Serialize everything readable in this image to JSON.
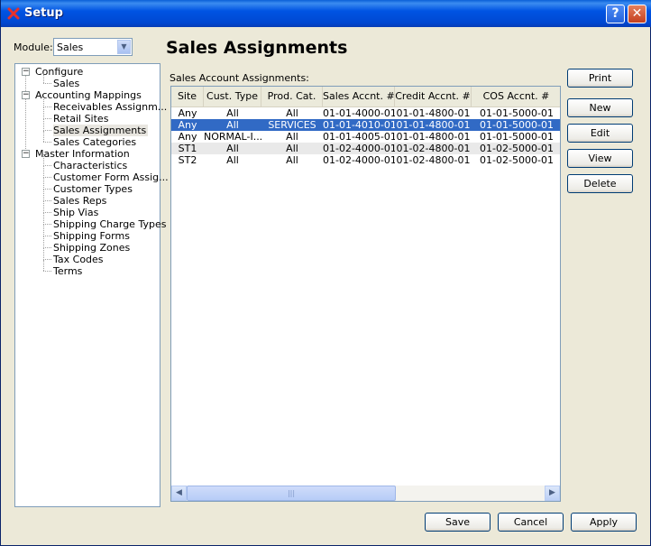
{
  "window": {
    "title": "Setup",
    "help_glyph": "?",
    "close_glyph": "✕"
  },
  "module": {
    "label": "Module:",
    "value": "Sales",
    "arrow": "▼"
  },
  "tree": [
    {
      "label": "Configure",
      "level": 0,
      "expander": "−"
    },
    {
      "label": "Sales",
      "level": 1
    },
    {
      "label": "Accounting Mappings",
      "level": 0,
      "expander": "−"
    },
    {
      "label": "Receivables Assignm...",
      "level": 1
    },
    {
      "label": "Retail Sites",
      "level": 1
    },
    {
      "label": "Sales Assignments",
      "level": 1,
      "selected": true
    },
    {
      "label": "Sales Categories",
      "level": 1
    },
    {
      "label": "Master Information",
      "level": 0,
      "expander": "−"
    },
    {
      "label": "Characteristics",
      "level": 1
    },
    {
      "label": "Customer Form Assig...",
      "level": 1
    },
    {
      "label": "Customer Types",
      "level": 1
    },
    {
      "label": "Sales Reps",
      "level": 1
    },
    {
      "label": "Ship Vias",
      "level": 1
    },
    {
      "label": "Shipping Charge Types",
      "level": 1
    },
    {
      "label": "Shipping Forms",
      "level": 1
    },
    {
      "label": "Shipping Zones",
      "level": 1
    },
    {
      "label": "Tax Codes",
      "level": 1
    },
    {
      "label": "Terms",
      "level": 1
    }
  ],
  "page": {
    "title": "Sales Assignments",
    "table_caption": "Sales Account Assignments:"
  },
  "table": {
    "columns": [
      "Site",
      "Cust. Type",
      "Prod. Cat.",
      "Sales Accnt. #",
      "Credit Accnt. #",
      "COS Accnt. #"
    ],
    "rows": [
      [
        "Any",
        "All",
        "All",
        "01-01-4000-01",
        "01-01-4800-01",
        "01-01-5000-01"
      ],
      [
        "Any",
        "All",
        "SERVICES",
        "01-01-4010-01",
        "01-01-4800-01",
        "01-01-5000-01"
      ],
      [
        "Any",
        "NORMAL-I...",
        "All",
        "01-01-4005-01",
        "01-01-4800-01",
        "01-01-5000-01"
      ],
      [
        "ST1",
        "All",
        "All",
        "01-02-4000-01",
        "01-02-4800-01",
        "01-02-5000-01"
      ],
      [
        "ST2",
        "All",
        "All",
        "01-02-4000-01",
        "01-02-4800-01",
        "01-02-5000-01"
      ]
    ],
    "selected_row": 1,
    "scrollbar": {
      "left_glyph": "◀",
      "right_glyph": "▶",
      "thumb_grip": "|||"
    }
  },
  "buttons": {
    "print": "Print",
    "new": "New",
    "edit": "Edit",
    "view": "View",
    "delete": "Delete",
    "save": "Save",
    "cancel": "Cancel",
    "apply": "Apply"
  }
}
